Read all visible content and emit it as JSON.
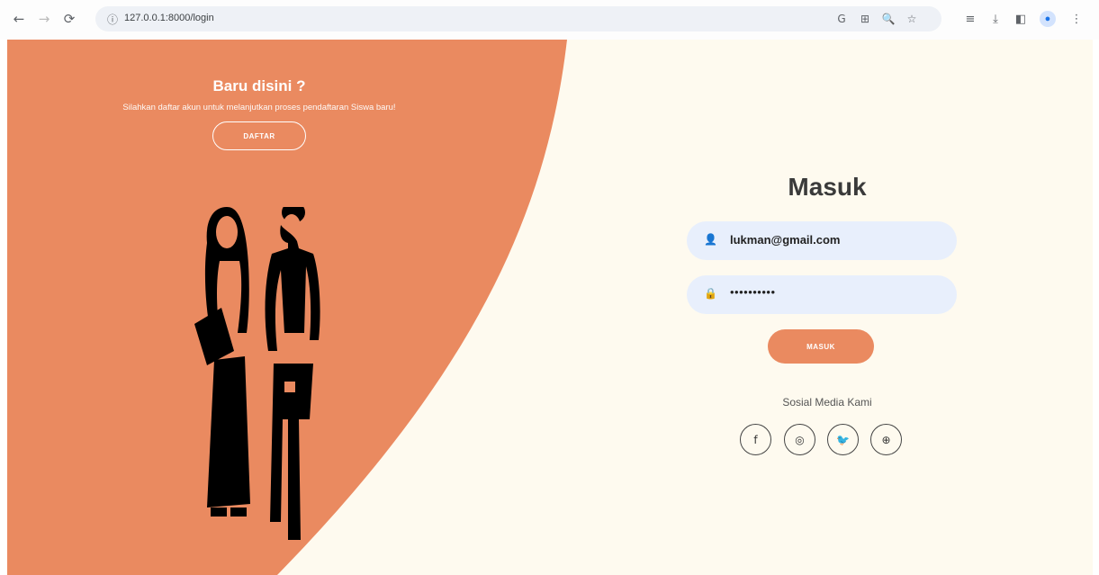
{
  "browser": {
    "back": "←",
    "forward": "→",
    "reload": "⟳",
    "info": "ⓘ",
    "url": "127.0.0.1:8000/login",
    "omnibox_icons": [
      "G",
      "⊞",
      "🔍",
      "☆"
    ],
    "extension_icons": [
      "≡",
      "⤓",
      "◧"
    ],
    "profile": "●",
    "menu": "⋮"
  },
  "welcome": {
    "title": "Baru disini ?",
    "description": "Silahkan daftar akun untuk melanjutkan proses pendaftaran Siswa baru!",
    "register_label": "DAFTAR"
  },
  "login": {
    "title": "Masuk",
    "email_icon": "👤",
    "email_value": "lukman@gmail.com",
    "password_icon": "🔒",
    "password_value": "••••••••••",
    "submit_label": "MASUK",
    "social_label": "Sosial Media Kami",
    "social": [
      "f",
      "◎",
      "🐦",
      "⊕"
    ]
  },
  "colors": {
    "accent": "#ea8a60",
    "background": "#fefaef",
    "input": "#e8effc"
  }
}
